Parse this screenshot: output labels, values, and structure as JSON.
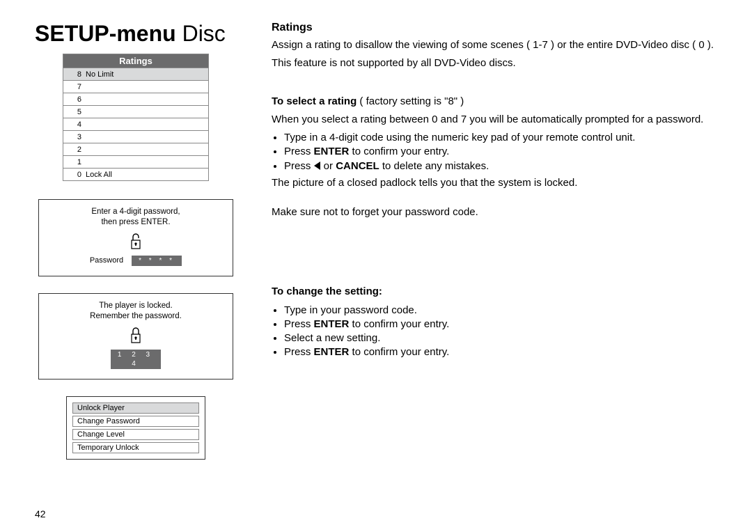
{
  "page_number": "42",
  "title": {
    "bold": "SETUP-menu",
    "light": " Disc"
  },
  "ratings_panel": {
    "header": "Ratings",
    "rows": [
      {
        "num": "8",
        "label": "No Limit",
        "highlight": true
      },
      {
        "num": "7",
        "label": ""
      },
      {
        "num": "6",
        "label": ""
      },
      {
        "num": "5",
        "label": ""
      },
      {
        "num": "4",
        "label": ""
      },
      {
        "num": "3",
        "label": ""
      },
      {
        "num": "2",
        "label": ""
      },
      {
        "num": "1",
        "label": ""
      },
      {
        "num": "0",
        "label": "Lock All"
      }
    ]
  },
  "enter_password_panel": {
    "line1": "Enter a 4-digit password,",
    "line2": "then press ENTER.",
    "password_label": "Password",
    "password_mask": "* * * *"
  },
  "locked_panel": {
    "line1": "The player is locked.",
    "line2": "Remember the password.",
    "code": "1 2 3 4"
  },
  "options_panel": {
    "items": [
      {
        "label": "Unlock Player",
        "highlight": true
      },
      {
        "label": "Change Password",
        "highlight": false
      },
      {
        "label": "Change Level",
        "highlight": false
      },
      {
        "label": "Temporary Unlock",
        "highlight": false
      }
    ]
  },
  "right": {
    "heading": "Ratings",
    "intro1": "Assign a rating to disallow the viewing of some scenes ( 1-7 ) or the entire DVD-Video disc ( 0 ).",
    "intro2": "This feature is not supported by all DVD-Video discs.",
    "select_label_bold": "To select a rating",
    "select_label_rest": " ( factory setting is \"8\" )",
    "select_para": "When you select a rating between 0 and 7 you will be automatically prompted for a password.",
    "bullets1_a": "Type in a 4-digit code using the numeric key pad of your remote control unit.",
    "bullets1_b_pre": "Press ",
    "bullets1_b_bold": "ENTER",
    "bullets1_b_post": " to confirm your entry.",
    "bullets1_c_pre": "Press ",
    "bullets1_c_mid": " or ",
    "bullets1_c_bold": "CANCEL",
    "bullets1_c_post": " to delete any mistakes.",
    "closed_para": "The picture of a closed padlock tells you that the system is locked.",
    "remember_para": "Make sure not to forget your password code.",
    "change_heading": "To change the setting:",
    "bullets2_a": "Type in your password code.",
    "bullets2_b_pre": "Press ",
    "bullets2_b_bold": "ENTER",
    "bullets2_b_post": " to confirm your entry.",
    "bullets2_c": "Select a new setting.",
    "bullets2_d_pre": "Press ",
    "bullets2_d_bold": "ENTER",
    "bullets2_d_post": " to confirm your entry."
  }
}
